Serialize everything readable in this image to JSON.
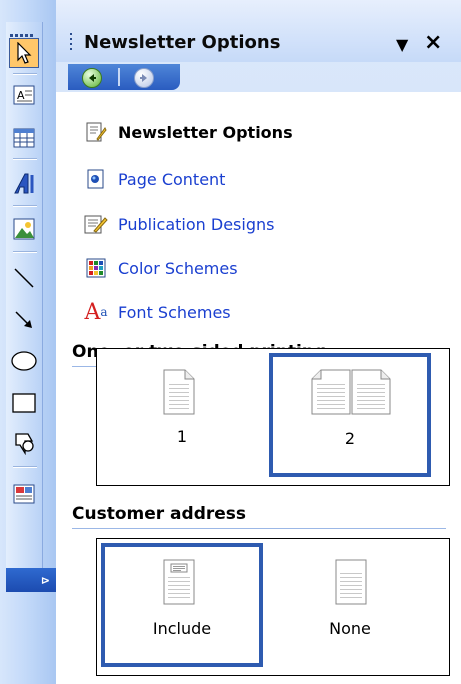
{
  "pane": {
    "title": "Newsletter Options",
    "dropdown_glyph": "▼",
    "close_glyph": "×"
  },
  "nav": {
    "back_icon": "back-arrow-icon",
    "forward_icon": "forward-arrow-icon"
  },
  "links": [
    {
      "label": "Newsletter Options",
      "icon": "newsletter-options-icon",
      "current": true
    },
    {
      "label": "Page Content",
      "icon": "page-content-icon",
      "current": false
    },
    {
      "label": "Publication Designs",
      "icon": "publication-designs-icon",
      "current": false
    },
    {
      "label": "Color Schemes",
      "icon": "color-schemes-icon",
      "current": false
    },
    {
      "label": "Font Schemes",
      "icon": "font-schemes-icon",
      "current": false
    }
  ],
  "printing": {
    "heading": "One- or two-sided printing",
    "options": [
      {
        "label": "1",
        "selected": false
      },
      {
        "label": "2",
        "selected": true
      }
    ]
  },
  "address": {
    "heading": "Customer address",
    "options": [
      {
        "label": "Include",
        "selected": true
      },
      {
        "label": "None",
        "selected": false
      }
    ]
  },
  "toolbar": {
    "tools": [
      "select-pointer-icon",
      "text-box-icon",
      "table-icon",
      "wordart-icon",
      "picture-icon",
      "line-icon",
      "arrow-icon",
      "oval-icon",
      "rectangle-icon",
      "autoshapes-icon",
      "design-gallery-icon"
    ],
    "overflow_glyph": "⊳"
  },
  "colors": {
    "link": "#1a3fd0",
    "selection": "#2e5bb0",
    "nav_bar": "#2a5cc0",
    "toolbar": "#c4daf9"
  }
}
